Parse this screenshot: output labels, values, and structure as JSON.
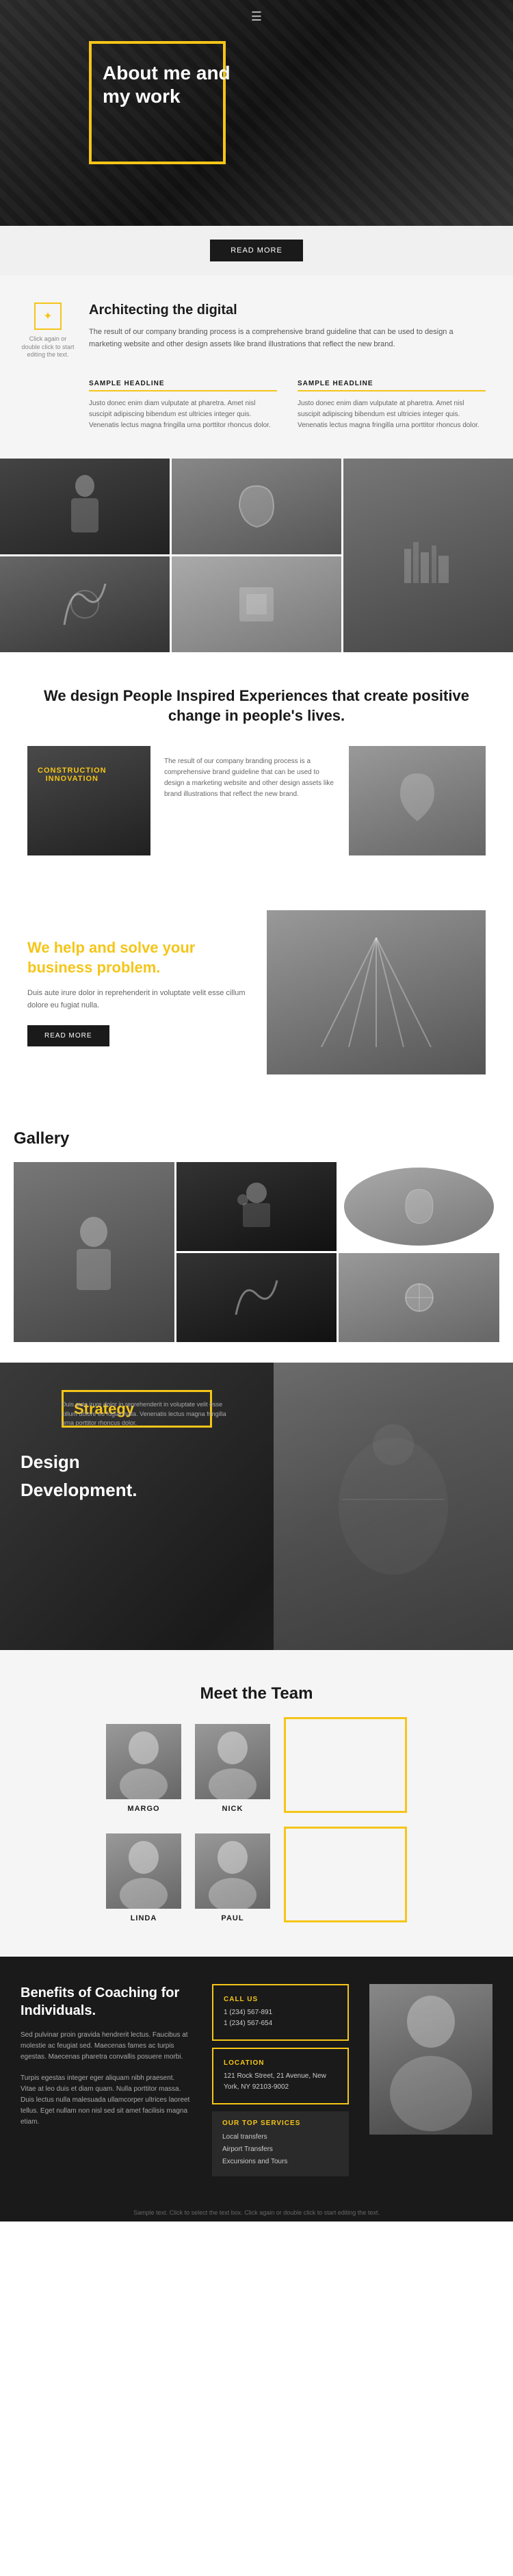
{
  "header": {
    "hamburger": "☰"
  },
  "hero": {
    "title": "About me and my work"
  },
  "read_more": {
    "label": "READ MORE"
  },
  "about": {
    "edit_hint": "Click again or double click to start editing the text.",
    "edit_icon": "✦",
    "title": "Architecting the digital",
    "desc": "The result of our company branding process is a comprehensive brand guideline that can be used to design a marketing website and other design assets like brand illustrations that reflect the new brand.",
    "col1": {
      "headline": "SAMPLE HEADLINE",
      "text": "Justo donec enim diam vulputate at pharetra. Amet nisl suscipit adipiscing bibendum est ultricies integer quis. Venenatis lectus magna fringilla urna porttitor rhoncus dolor."
    },
    "col2": {
      "headline": "SAMPLE HEADLINE",
      "text": "Justo donec enim diam vulputate at pharetra. Amet nisl suscipit adipiscing bibendum est ultricies integer quis. Venenatis lectus magna fringilla urna porttitor rhoncus dolor."
    }
  },
  "inspired": {
    "title": "We design People Inspired Experiences that create positive change in people's lives.",
    "construction_label": "CONSTRUCTION",
    "innovation_label": "INNOVATION",
    "text": "The result of our company branding process is a comprehensive brand guideline that can be used to design a marketing website and other design assets like brand illustrations that reflect the new brand."
  },
  "business": {
    "title_part1": "We help and solve your",
    "title_part2": "business",
    "title_highlight": "problem.",
    "desc": "Duis aute irure dolor in reprehenderit in voluptate velit esse cillum dolore eu fugiat nulla.",
    "btn_label": "READ MORE"
  },
  "gallery": {
    "title": "Gallery"
  },
  "strategy": {
    "label": "Strategy",
    "item1": "Design",
    "item2": "Development.",
    "desc": "Duis aute irure dolor in reprehenderit in voluptate velit esse cillum dolore eu fugiat nulla. Venenatis lectus magna fringilla urna porttitor rhoncus dolor."
  },
  "team": {
    "title": "Meet the Team",
    "members": [
      {
        "name": "MARGO"
      },
      {
        "name": "NICK"
      },
      {
        "name": "LINDA"
      },
      {
        "name": "PAUL"
      }
    ]
  },
  "benefits": {
    "title": "Benefits of Coaching for Individuals.",
    "desc1": "Sed pulvinar proin gravida hendrerit lectus. Faucibus at molestie ac feugiat sed. Maecenas fames ac turpis egestas. Maecenas pharetra convallis posuere morbi.",
    "desc2": "Turpis egestas integer eger aliquam nibh praesent. Vitae at leo duis et diam quam. Nulla porttitor massa. Duis lectus nulla malesuada ullamcorper ultrices laoreet tellus. Eget nullam non nisl sed sit amet facilisis magna etiam.",
    "contact": {
      "call_us_label": "CALL US",
      "phone1": "1 (234) 567-891",
      "phone2": "1 (234) 567-654",
      "location_label": "LOCATION",
      "address": "121 Rock Street, 21 Avenue,\nNew York, NY 92103-9002"
    },
    "services": {
      "title": "OUR TOP SERVICES",
      "items": [
        "Local transfers",
        "Airport Transfers",
        "Excursions and Tours"
      ]
    }
  },
  "footer": {
    "hint": "Sample text. Click to select the text box. Click again or double click to start editing the text."
  }
}
